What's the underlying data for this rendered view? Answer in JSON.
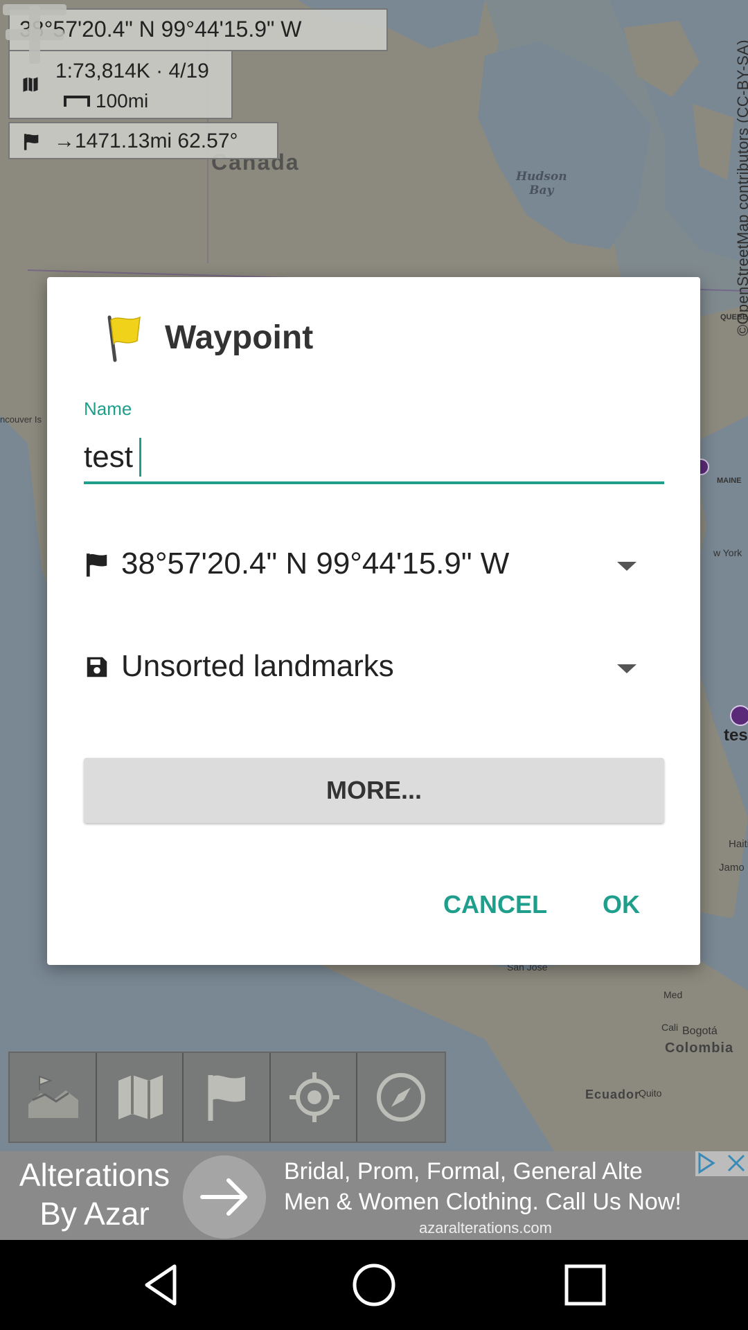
{
  "map": {
    "labels": {
      "canada": "Canada",
      "hudson_bay_line1": "Hudson",
      "hudson_bay_line2": "Bay",
      "new_york": "w York",
      "vancouver": "ncouver Is",
      "maine": "MAINE",
      "quebec": "QUEBE",
      "haiti": "Haiti",
      "jamaica": "Jamo",
      "san_jose": "San José",
      "medellin": "Med",
      "cali": "Cali",
      "bogota": "Bogotá",
      "colombia": "Colombia",
      "quito": "Quito",
      "ecuador": "Ecuador",
      "poi_label": "tes"
    },
    "attribution": "©OpenStreetMap contributors (CC-BY-SA)"
  },
  "info": {
    "coordinates": "38°57'20.4\" N 99°44'15.9\" W",
    "scale": "1:73,814K · 4/19",
    "scale_bar": "100mi",
    "distance": "→1471.13mi  62.57°"
  },
  "dialog": {
    "title": "Waypoint",
    "name_label": "Name",
    "name_value": "test",
    "coordinates_value": "38°57'20.4\" N 99°44'15.9\" W",
    "folder_value": "Unsorted landmarks",
    "more_label": "MORE...",
    "cancel_label": "CANCEL",
    "ok_label": "OK"
  },
  "ad": {
    "left_line1": "Alterations",
    "left_line2": "By Azar",
    "right_line1": "Bridal, Prom, Formal, General Alte",
    "right_line2": "Men & Women Clothing. Call Us Now!",
    "url": "azaralterations.com"
  },
  "colors": {
    "accent": "#1f9e8c",
    "dialog_bg": "#ffffff",
    "more_button_bg": "#dcdcdc"
  },
  "icons": {
    "dialog": "flag-icon",
    "coords_row": "flag-icon",
    "folder_row": "save-icon",
    "toolbar": [
      "map-app-icon",
      "map-icon",
      "flag-icon",
      "my-location-icon",
      "compass-icon"
    ],
    "nav": [
      "back-icon",
      "home-icon",
      "recents-icon"
    ]
  }
}
